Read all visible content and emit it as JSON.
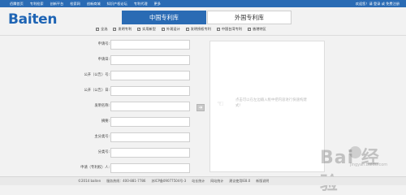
{
  "topnav": {
    "links": [
      "佰腾首页",
      "专利检索",
      "创新平台",
      "检索网",
      "创新商城",
      "知识产权论坛",
      "专利代理",
      "更多"
    ],
    "right": "欢迎您！请 登录 或 免费注册"
  },
  "logo": {
    "text": "Baiten"
  },
  "tabs": [
    {
      "label": "中国专利库",
      "active": true
    },
    {
      "label": "外国专利库",
      "active": false
    }
  ],
  "db_options": [
    {
      "label": "全选",
      "checked": true
    },
    {
      "label": "发明专利",
      "checked": true
    },
    {
      "label": "实用新型",
      "checked": true
    },
    {
      "label": "外观设计",
      "checked": true
    },
    {
      "label": "发明授权专利",
      "checked": true
    },
    {
      "label": "中国台湾专利",
      "checked": true
    },
    {
      "label": "香港特区",
      "checked": true
    }
  ],
  "form": {
    "fields": [
      {
        "label": "申请号:",
        "value": ""
      },
      {
        "label": "申请日:",
        "value": ""
      },
      {
        "label": "公开（公告）号:",
        "value": ""
      },
      {
        "label": "公开（公告）日:",
        "value": ""
      },
      {
        "label": "发明名称:",
        "value": ""
      },
      {
        "label": "摘要:",
        "value": ""
      },
      {
        "label": "主分类号:",
        "value": ""
      },
      {
        "label": "分类号:",
        "value": ""
      },
      {
        "label": "申请（专利权）人:",
        "value": ""
      }
    ]
  },
  "arrow_button": {
    "glyph": "➜"
  },
  "panel": {
    "hint": "点击可以在左边输入框中把内容进行快速构建式！"
  },
  "footer": {
    "items": [
      "©2014 baiten",
      "服务热线：400-881-7786",
      "苏ICP备09077504号-3",
      "站长统计",
      "网站统计",
      "建议使用IE8.0",
      "新版说明"
    ]
  },
  "watermark": {
    "brand": "Bai 经验",
    "url": "jingyan.baidu.com"
  }
}
